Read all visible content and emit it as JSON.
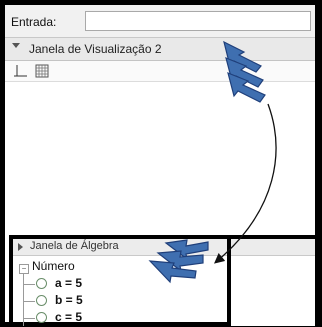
{
  "input_bar": {
    "label": "Entrada:",
    "value": ""
  },
  "graphics_view": {
    "title": "Janela de Visualização 2",
    "toolbar": [
      {
        "icon": "axes-icon"
      },
      {
        "icon": "grid-icon"
      }
    ]
  },
  "algebra_view": {
    "title": "Janela de Álgebra",
    "group": "Número",
    "items": [
      {
        "label": "a = 5"
      },
      {
        "label": "b = 5"
      },
      {
        "label": "c = 5"
      }
    ]
  },
  "colors": {
    "frame": "#000000",
    "arrow_fill": "#3f6fb0",
    "arrow_stroke": "#1f3f7a",
    "radio": "#6a8e6a"
  }
}
